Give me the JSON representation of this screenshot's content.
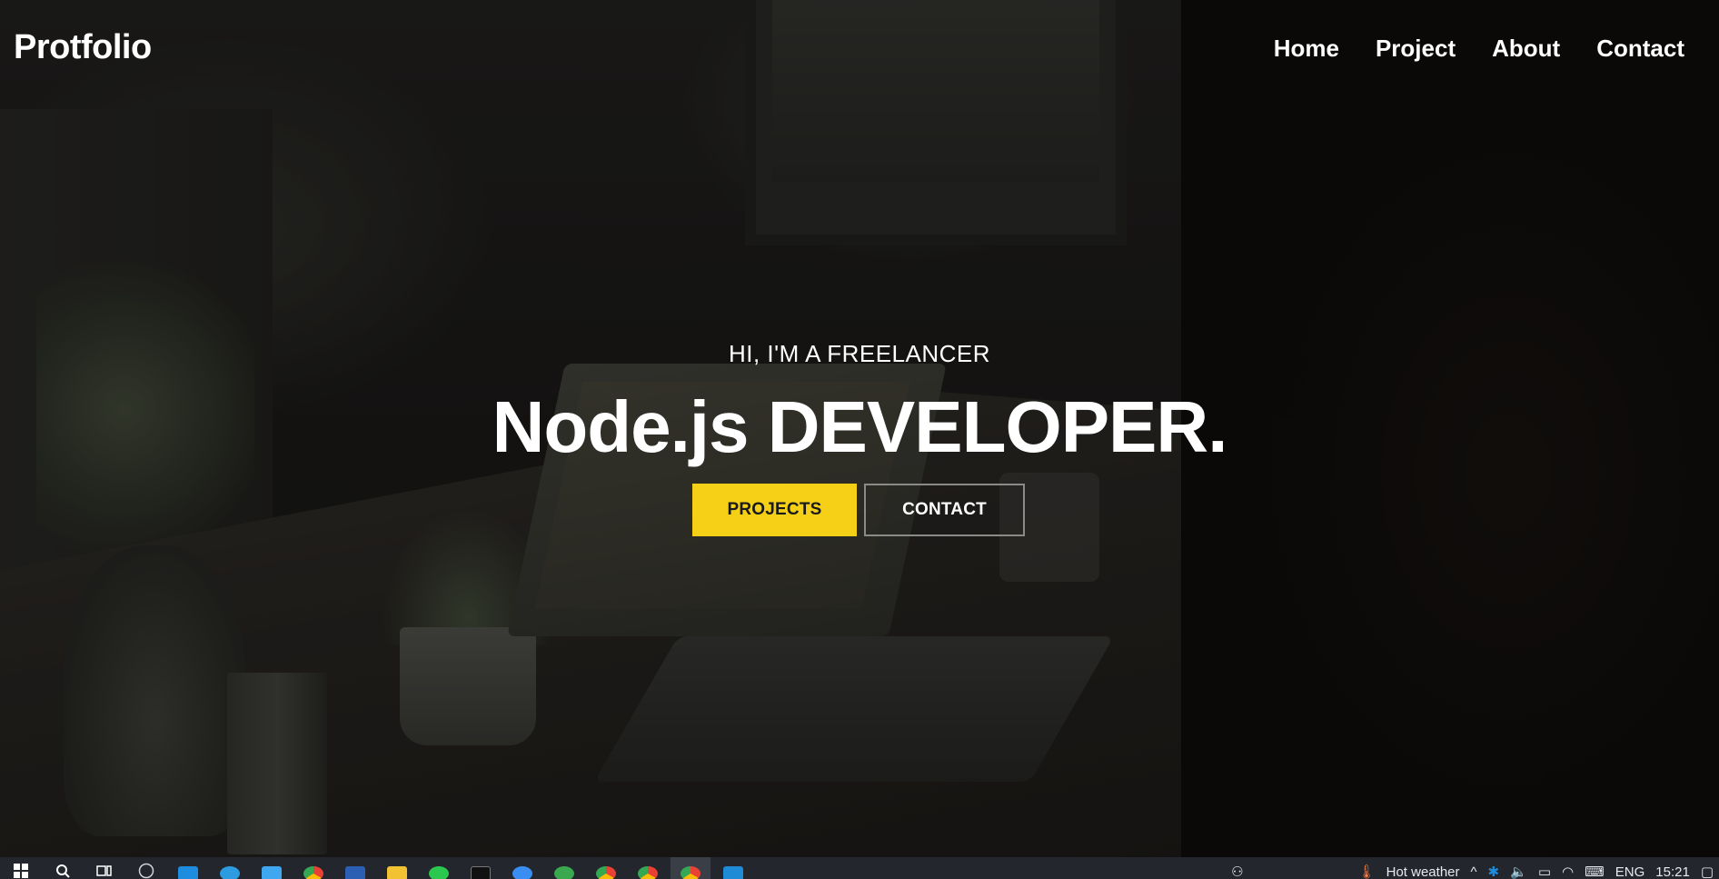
{
  "brand": {
    "name": "Protfolio"
  },
  "nav": {
    "items": [
      {
        "label": "Home"
      },
      {
        "label": "Project"
      },
      {
        "label": "About"
      },
      {
        "label": "Contact"
      }
    ]
  },
  "hero": {
    "subtitle": "HI, I'M A FREELANCER",
    "title": "Node.js DEVELOPER.",
    "buttons": {
      "primary": "PROJECTS",
      "secondary": "CONTACT"
    }
  },
  "colors": {
    "accent": "#f5d017",
    "text": "#ffffff",
    "taskbar": "#23272d"
  },
  "taskbar": {
    "apps": [
      "start-icon",
      "search-icon",
      "task-view-icon",
      "dell-icon",
      "mail-icon",
      "edge-icon",
      "store-icon",
      "chrome-icon",
      "word-icon",
      "file-explorer-icon",
      "whatsapp-icon",
      "terminal-icon",
      "app-store-icon",
      "mongodb-icon",
      "chrome-alt-icon",
      "chrome-profile-icon",
      "chrome-active-icon",
      "vscode-icon"
    ],
    "tray": {
      "weather": "Hot weather",
      "language": "ENG",
      "time": "15:21"
    }
  }
}
